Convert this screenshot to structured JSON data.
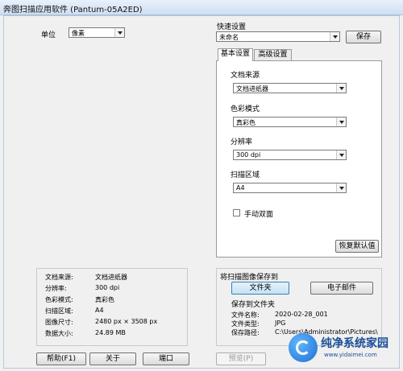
{
  "window": {
    "title": "奔图扫描应用软件 (Pantum-05A2ED)"
  },
  "unit": {
    "label": "单位",
    "value": "像素"
  },
  "quick": {
    "label": "快速设置",
    "value": "未命名",
    "save_label": "保存"
  },
  "tabs": [
    {
      "label": "基本设置",
      "active": true
    },
    {
      "label": "高级设置",
      "active": false
    }
  ],
  "basic": {
    "source_label": "文档来源",
    "source_value": "文档进纸器",
    "color_label": "色彩模式",
    "color_value": "真彩色",
    "resolution_label": "分辨率",
    "resolution_value": "300 dpi",
    "area_label": "扫描区域",
    "area_value": "A4",
    "duplex_label": "手动双面",
    "duplex_checked": false,
    "reset_label": "恢复默认值"
  },
  "info": {
    "rows": [
      {
        "key": "文档来源:",
        "value": "文档进纸器"
      },
      {
        "key": "分辨率:",
        "value": "300 dpi"
      },
      {
        "key": "色彩模式:",
        "value": "真彩色"
      },
      {
        "key": "扫描区域:",
        "value": "A4"
      },
      {
        "key": "图像尺寸:",
        "value": "2480 px × 3508 px"
      },
      {
        "key": "数据大小:",
        "value": "24.89 MB"
      }
    ]
  },
  "save_to": {
    "title": "将扫描图像保存到",
    "folder_button": "文件夹",
    "email_button": "电子邮件",
    "section_title": "保存到文件夹",
    "rows": [
      {
        "key": "文件名称:",
        "value": "2020-02-28_001"
      },
      {
        "key": "文件类型:",
        "value": "JPG"
      },
      {
        "key": "保存路径:",
        "value": "C:\\Users\\Administrator\\Pictures\\"
      }
    ]
  },
  "footer": {
    "help": "帮助(F1)",
    "about": "关于",
    "port": "端口",
    "preview": "预览(P)"
  },
  "watermark": {
    "title": "纯净系统家园",
    "url": "www.yidaimei.com"
  }
}
